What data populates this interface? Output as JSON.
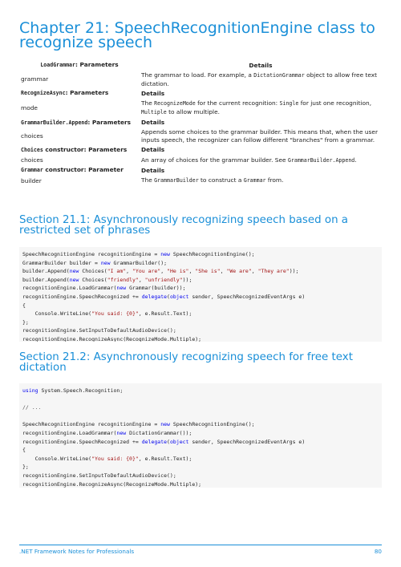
{
  "chapter": {
    "title": "Chapter 21: SpeechRecognitionEngine class to recognize speech"
  },
  "table": {
    "rows": [
      {
        "kind": "head1",
        "left_code": "LoadGrammar",
        "left_text": ": Parameters",
        "right": "Details"
      },
      {
        "kind": "body",
        "left": "grammar",
        "right_pre": "The grammar to load. For example, a ",
        "right_code": "DictationGrammar",
        "right_post": " object to allow free text dictation."
      },
      {
        "kind": "head",
        "left_code": "RecognizeAsync",
        "left_text": ": Parameters",
        "right": "Details"
      },
      {
        "kind": "body",
        "left": "mode",
        "right_pre": "The ",
        "right_code": "RecognizeMode",
        "right_mid": " for the current recognition: ",
        "right_code2": "Single",
        "right_mid2": " for just one recognition, ",
        "right_code3": "Multiple",
        "right_post": " to allow multiple."
      },
      {
        "kind": "head",
        "left_code": "GrammarBuilder.Append",
        "left_text": ": Parameters",
        "right": "Details"
      },
      {
        "kind": "body",
        "left": "choices",
        "right_pre": "Appends some choices to the grammar builder. This means that, when the user inputs speech, the recognizer can follow different \"branches\" from a grammar."
      },
      {
        "kind": "head",
        "left_code": "Choices",
        "left_text": " constructor: Parameters",
        "right": "Details"
      },
      {
        "kind": "body",
        "left": "choices",
        "right_pre": "An array of choices for the grammar builder. See ",
        "right_code": "GrammarBuilder.Append",
        "right_post": "."
      },
      {
        "kind": "head",
        "left_code": "Grammar",
        "left_text": " constructor: Parameter",
        "right": "Details"
      },
      {
        "kind": "body",
        "left": "builder",
        "right_pre": "The ",
        "right_code": "GrammarBuilder",
        "right_mid": " to construct a ",
        "right_code2": "Grammar",
        "right_post": " from."
      }
    ]
  },
  "section1": {
    "title": "Section 21.1: Asynchronously recognizing speech based on a restricted set of phrases",
    "code": [
      [
        [
          "t",
          "SpeechRecognitionEngine recognitionEngine = "
        ],
        [
          "k",
          "new"
        ],
        [
          "t",
          " SpeechRecognitionEngine();"
        ]
      ],
      [
        [
          "t",
          "GrammarBuilder builder = "
        ],
        [
          "k",
          "new"
        ],
        [
          "t",
          " GrammarBuilder();"
        ]
      ],
      [
        [
          "t",
          "builder.Append("
        ],
        [
          "k",
          "new"
        ],
        [
          "t",
          " Choices("
        ],
        [
          "s",
          "\"I am\""
        ],
        [
          "t",
          ", "
        ],
        [
          "s",
          "\"You are\""
        ],
        [
          "t",
          ", "
        ],
        [
          "s",
          "\"He is\""
        ],
        [
          "t",
          ", "
        ],
        [
          "s",
          "\"She is\""
        ],
        [
          "t",
          ", "
        ],
        [
          "s",
          "\"We are\""
        ],
        [
          "t",
          ", "
        ],
        [
          "s",
          "\"They are\""
        ],
        [
          "t",
          "));"
        ]
      ],
      [
        [
          "t",
          "builder.Append("
        ],
        [
          "k",
          "new"
        ],
        [
          "t",
          " Choices("
        ],
        [
          "s",
          "\"friendly\""
        ],
        [
          "t",
          ", "
        ],
        [
          "s",
          "\"unfriendly\""
        ],
        [
          "t",
          "));"
        ]
      ],
      [
        [
          "t",
          "recognitionEngine.LoadGrammar("
        ],
        [
          "k",
          "new"
        ],
        [
          "t",
          " Grammar(builder));"
        ]
      ],
      [
        [
          "t",
          "recognitionEngine.SpeechRecognized += "
        ],
        [
          "k",
          "delegate"
        ],
        [
          "t",
          "("
        ],
        [
          "k",
          "object"
        ],
        [
          "t",
          " sender, SpeechRecognizedEventArgs e)"
        ]
      ],
      [
        [
          "t",
          "{"
        ]
      ],
      [
        [
          "t",
          "    Console.WriteLine("
        ],
        [
          "s",
          "\"You said: {0}\""
        ],
        [
          "t",
          ", e.Result.Text);"
        ]
      ],
      [
        [
          "t",
          "};"
        ]
      ],
      [
        [
          "t",
          "recognitionEngine.SetInputToDefaultAudioDevice();"
        ]
      ],
      [
        [
          "t",
          "recognitionEngine.RecognizeAsync(RecognizeMode.Multiple);"
        ]
      ]
    ]
  },
  "section2": {
    "title": "Section 21.2: Asynchronously recognizing speech for free text dictation",
    "code": [
      [
        [
          "k",
          "using"
        ],
        [
          "t",
          " System.Speech.Recognition;"
        ]
      ],
      [
        [
          "t",
          ""
        ]
      ],
      [
        [
          "c",
          "// ..."
        ]
      ],
      [
        [
          "t",
          ""
        ]
      ],
      [
        [
          "t",
          "SpeechRecognitionEngine recognitionEngine = "
        ],
        [
          "k",
          "new"
        ],
        [
          "t",
          " SpeechRecognitionEngine();"
        ]
      ],
      [
        [
          "t",
          "recognitionEngine.LoadGrammar("
        ],
        [
          "k",
          "new"
        ],
        [
          "t",
          " DictationGrammar());"
        ]
      ],
      [
        [
          "t",
          "recognitionEngine.SpeechRecognized += "
        ],
        [
          "k",
          "delegate"
        ],
        [
          "t",
          "("
        ],
        [
          "k",
          "object"
        ],
        [
          "t",
          " sender, SpeechRecognizedEventArgs e)"
        ]
      ],
      [
        [
          "t",
          "{"
        ]
      ],
      [
        [
          "t",
          "    Console.WriteLine("
        ],
        [
          "s",
          "\"You said: {0}\""
        ],
        [
          "t",
          ", e.Result.Text);"
        ]
      ],
      [
        [
          "t",
          "};"
        ]
      ],
      [
        [
          "t",
          "recognitionEngine.SetInputToDefaultAudioDevice();"
        ]
      ],
      [
        [
          "t",
          "recognitionEngine.RecognizeAsync(RecognizeMode.Multiple);"
        ]
      ]
    ]
  },
  "footer": {
    "book": ".NET Framework Notes for Professionals",
    "page": "80"
  }
}
